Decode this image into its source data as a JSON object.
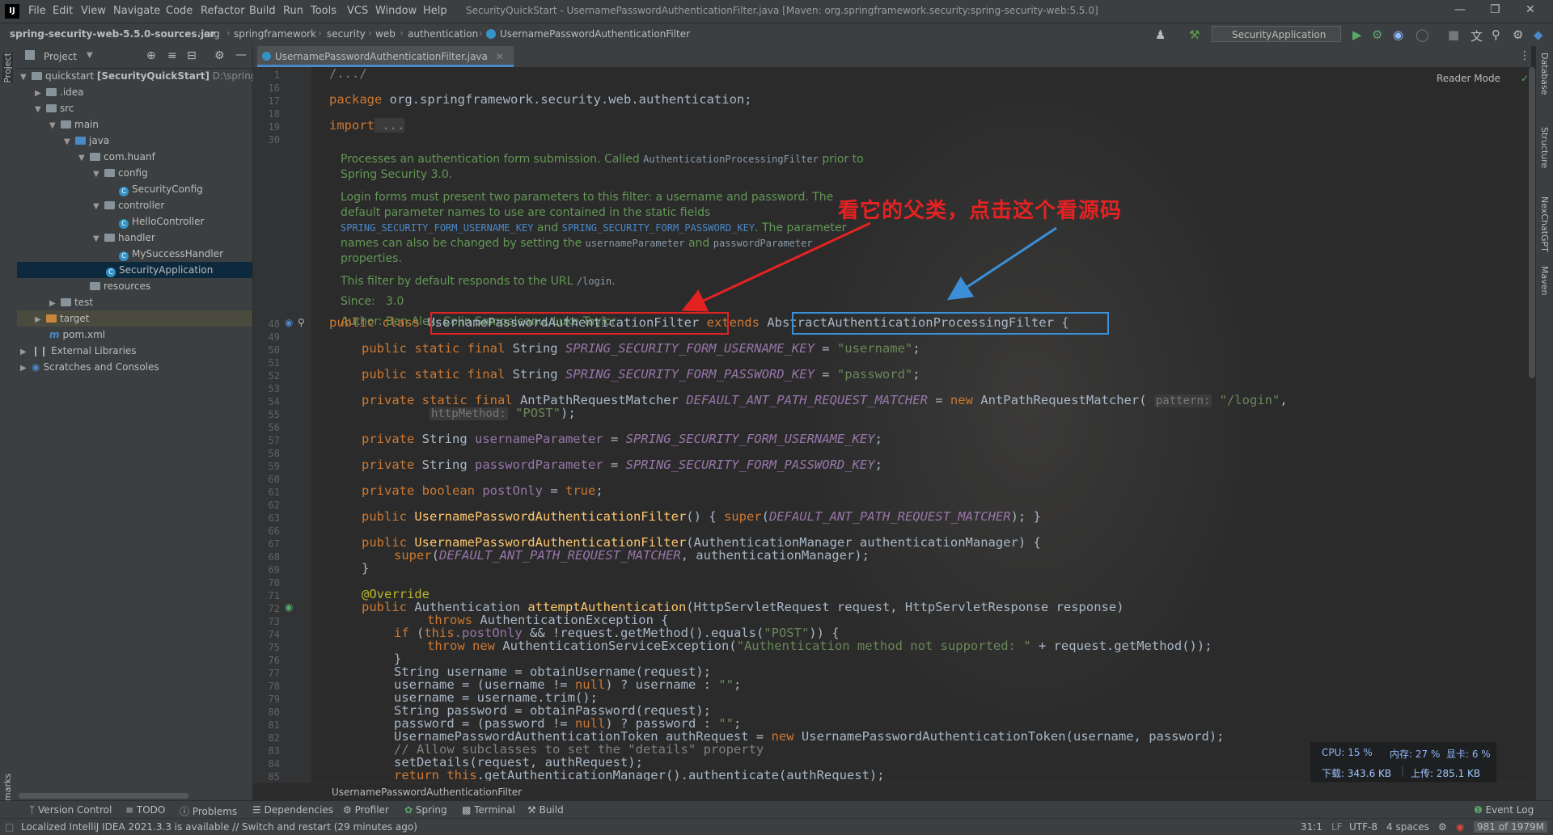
{
  "titlebar": {
    "logo": "IJ",
    "menus": [
      "File",
      "Edit",
      "View",
      "Navigate",
      "Code",
      "Refactor",
      "Build",
      "Run",
      "Tools",
      "VCS",
      "Window",
      "Help"
    ],
    "window_title": "SecurityQuickStart - UsernamePasswordAuthenticationFilter.java [Maven: org.springframework.security:spring-security-web:5.5.0]"
  },
  "navbar": {
    "crumbs": [
      "spring-security-web-5.5.0-sources.jar",
      "org",
      "springframework",
      "security",
      "web",
      "authentication",
      "UsernamePasswordAuthenticationFilter"
    ],
    "run_config": "SecurityApplication"
  },
  "project": {
    "header": "Project",
    "tree": [
      {
        "label": "quickstart",
        "bold": "[SecurityQuickStart]",
        "extra": "D:\\springs"
      },
      {
        "label": ".idea"
      },
      {
        "label": "src"
      },
      {
        "label": "main"
      },
      {
        "label": "java"
      },
      {
        "label": "com.huanf"
      },
      {
        "label": "config"
      },
      {
        "label": "SecurityConfig"
      },
      {
        "label": "controller"
      },
      {
        "label": "HelloController"
      },
      {
        "label": "handler"
      },
      {
        "label": "MySuccessHandler"
      },
      {
        "label": "SecurityApplication"
      },
      {
        "label": "resources"
      },
      {
        "label": "test"
      },
      {
        "label": "target"
      },
      {
        "label": "pom.xml"
      },
      {
        "label": "External Libraries"
      },
      {
        "label": "Scratches and Consoles"
      }
    ]
  },
  "editor": {
    "tab": "UsernamePasswordAuthenticationFilter.java",
    "reader_mode": "Reader Mode",
    "annotation": "看它的父类，点击这个看源码",
    "line_numbers": [
      "1",
      "16",
      "17",
      "18",
      "19",
      "30",
      "48",
      "49",
      "50",
      "51",
      "52",
      "53",
      "54",
      "55",
      "56",
      "57",
      "58",
      "59",
      "60",
      "61",
      "62",
      "63",
      "66",
      "67",
      "68",
      "69",
      "70",
      "71",
      "72",
      "73",
      "74",
      "75",
      "76",
      "77",
      "78",
      "79",
      "80",
      "81",
      "82",
      "83",
      "84",
      "85"
    ],
    "doc": {
      "p1a": "Processes an authentication form submission. Called ",
      "p1code": "AuthenticationProcessingFilter",
      "p1b": " prior to Spring Security 3.0.",
      "p2a": "Login forms must present two parameters to this filter: a username and password. The default parameter names to use are contained in the static fields ",
      "p2code1": "SPRING_SECURITY_FORM_USERNAME_KEY",
      "p2b": " and ",
      "p2code2": "SPRING_SECURITY_FORM_PASSWORD_KEY",
      "p2c": ". The parameter names can also be changed by setting the ",
      "p2code3": "usernameParameter",
      "p2d": " and ",
      "p2code4": "passwordParameter",
      "p2e": " properties.",
      "p3a": "This filter by default responds to the URL ",
      "p3code": "/login",
      "p3b": ".",
      "since_label": "Since:",
      "since_value": "3.0",
      "author": "Author: Ben Alex, Colin Sampaleanu, Luke Taylor"
    },
    "code": {
      "fold": "/.../",
      "package_kw": "package",
      "package_name": " org.springframework.security.web.authentication;",
      "import_kw": "import",
      "import_fold": " ...",
      "class_decl": "public class",
      "class_name": "UsernamePasswordAuthenticationFilter",
      "extends_kw": "extends",
      "parent_class": "AbstractAuthenticationProcessingFilter",
      "brace": " {",
      "l50_kw": "public static final",
      "l50_type": " String ",
      "l50_fld": "SPRING_SECURITY_FORM_USERNAME_KEY",
      "l50_eq": " = ",
      "l50_str": "\"username\"",
      "l50_end": ";",
      "l52_fld": "SPRING_SECURITY_FORM_PASSWORD_KEY",
      "l52_str": "\"password\"",
      "l54_kw": "private static final",
      "l54_type": " AntPathRequestMatcher ",
      "l54_fld": "DEFAULT_ANT_PATH_REQUEST_MATCHER",
      "l54_new": "new",
      "l54_call": " AntPathRequestMatcher( ",
      "l54_hint": "pattern:",
      "l54_str": " \"/login\"",
      "l54_comma": ",",
      "l55_hint": "httpMethod:",
      "l55_str": " \"POST\"",
      "l55_end": ");",
      "l57_kw": "private",
      "l57_type": " String ",
      "l57_var": "usernameParameter",
      "l57_fld": "SPRING_SECURITY_FORM_USERNAME_KEY",
      "l59_var": "passwordParameter",
      "l59_fld": "SPRING_SECURITY_FORM_PASSWORD_KEY",
      "l61_kw": "private boolean",
      "l61_var": " postOnly",
      "l61_true": "true",
      "l63_kw": "public",
      "l63_ctor": " UsernamePasswordAuthenticationFilter",
      "l63_rest": "() { ",
      "l63_super": "super",
      "l63_arg": "DEFAULT_ANT_PATH_REQUEST_MATCHER",
      "l63_end": "); }",
      "l67_args": "(AuthenticationManager authenticationManager) {",
      "l68_arg2": ", authenticationManager);",
      "l69": "}",
      "l71": "@Override",
      "l72_kw": "public",
      "l72_type": " Authentication ",
      "l72_mth": "attemptAuthentication",
      "l72_args": "(HttpServletRequest request, HttpServletResponse response)",
      "l73_kw": "throws",
      "l73_rest": " AuthenticationException {",
      "l74_kw": "if",
      "l74_a": " (",
      "l74_this": "this",
      "l74_fld": ".postOnly",
      "l74_b": " && !request.getMethod().equals(",
      "l74_str": "\"POST\"",
      "l74_c": ")) {",
      "l75_kw": "throw new",
      "l75_a": " AuthenticationServiceException(",
      "l75_str": "\"Authentication method not supported: \"",
      "l75_b": " + request.getMethod());",
      "l76": "}",
      "l77": "String username = obtainUsername(request);",
      "l78_a": "username = (username != ",
      "l78_null": "null",
      "l78_b": ") ? username : ",
      "l78_str": "\"\"",
      "l78_c": ";",
      "l79": "username = username.trim();",
      "l80": "String password = obtainPassword(request);",
      "l81_a": "password = (password != ",
      "l81_b": ") ? password : ",
      "l82_a": "UsernamePasswordAuthenticationToken authRequest = ",
      "l82_new": "new",
      "l82_b": " UsernamePasswordAuthenticationToken(username, password);",
      "l83": "// Allow subclasses to set the \"details\" property",
      "l84": "setDetails(request, authRequest);",
      "l85_kw": "return this",
      "l85_b": ".getAuthenticationManager().authenticate(authRequest);"
    },
    "breadcrumb": "UsernamePasswordAuthenticationFilter"
  },
  "monitor": {
    "cpu": "CPU: 15 %",
    "mem": "内存: 27 %",
    "gpu": "显卡: 6 %",
    "down": "下载: 343.6 KB",
    "up": "上传: 285.1 KB"
  },
  "left_strip": [
    "Project",
    "Bookmarks"
  ],
  "right_strip": [
    "Database",
    "Structure",
    "NexChatGPT",
    "Maven"
  ],
  "tool_windows": [
    "Version Control",
    "TODO",
    "Problems",
    "Dependencies",
    "Profiler",
    "Spring",
    "Terminal",
    "Build"
  ],
  "event_log": "Event Log",
  "status": {
    "message": "Localized IntelliJ IDEA 2021.3.3 is available // Switch and restart (29 minutes ago)",
    "position": "31:1",
    "line_sep": "LF",
    "encoding": "UTF-8",
    "indent": "4 spaces",
    "memory": "981 of 1979M"
  },
  "colors": {
    "red_box": "#e02424",
    "blue_box": "#3a8fd6",
    "annotation": "#e52222"
  }
}
